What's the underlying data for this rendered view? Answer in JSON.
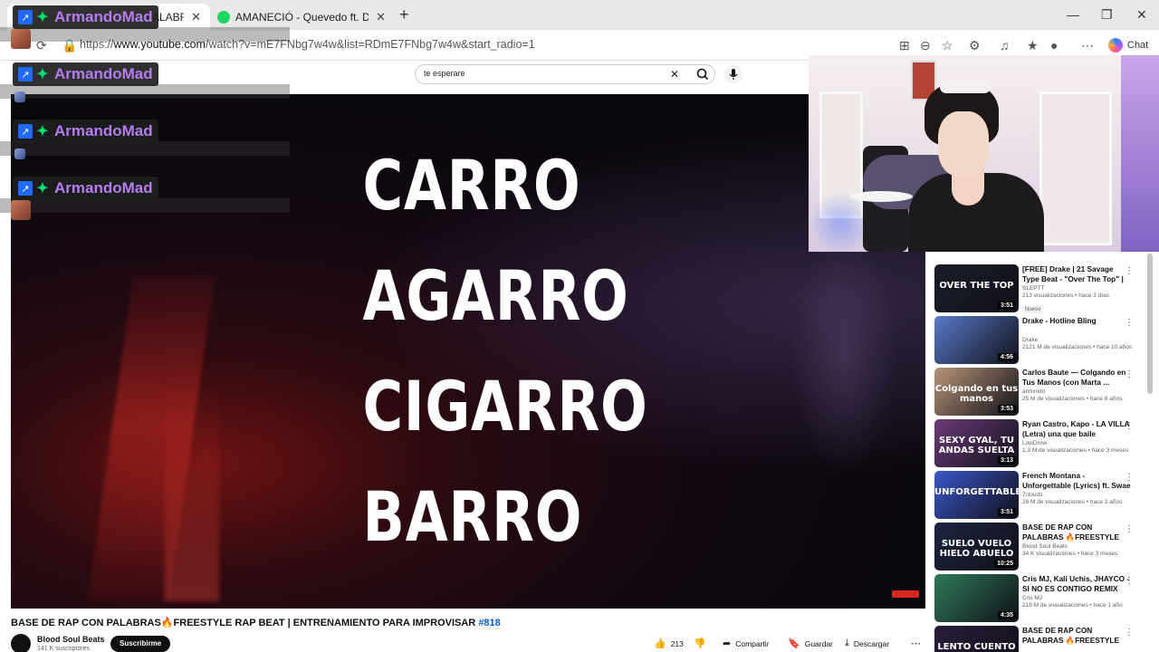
{
  "browser": {
    "tabs": [
      {
        "title": "ALABRA",
        "active": true
      },
      {
        "title": "AMANECIÓ - Quevedo ft. De La Rose",
        "active": false
      }
    ],
    "new_tab": "+",
    "url_prefix": "https://",
    "url_host": "www.youtube.com",
    "url_path": "/watch?v=mE7FNbg7w4w&list=RDmE7FNbg7w4w&start_radio=1",
    "chat_label": "Chat",
    "window_controls": [
      "—",
      "❐",
      "✕"
    ]
  },
  "youtube": {
    "search_value": "te esperare",
    "video": {
      "lyrics": [
        "CARRO",
        "AGARRO",
        "CIGARRO",
        "BARRO"
      ],
      "title": "BASE DE RAP CON PALABRAS🔥FREESTYLE RAP BEAT | ENTRENAMIENTO PARA IMPROVISAR",
      "hashtag": "#818"
    },
    "channel": {
      "name": "Blood Soul Beats",
      "subs": "141 K suscriptores",
      "subscribe_label": "Suscribirme"
    },
    "actions": {
      "likes": "213",
      "share": "Compartir",
      "save": "Guardar",
      "download": "Descargar"
    },
    "sidebar": [
      {
        "title": "[FREE] Drake | 21 Savage Type Beat - \"Over The Top\" | Hip Ho...",
        "channel": "SLEPTT",
        "stats": "213 visualizaciones • hace 3 días",
        "badge": "Nuevo",
        "duration": "3:51",
        "thumb_text": "OVER THE TOP",
        "thumb_color": "#1a1d2a"
      },
      {
        "title": "Drake - Hotline Bling",
        "channel": "Drake",
        "stats": "2121 M de visualizaciones • hace 10 años",
        "duration": "4:56",
        "thumb_text": "",
        "thumb_color": "#5a79c9"
      },
      {
        "title": "Carlos Baute — Colgando en Tus Manos (con Marta ...",
        "channel": "armxndo",
        "stats": "25 M de visualizaciones • hace 8 años",
        "duration": "3:53",
        "thumb_text": "Colgando en tus manos",
        "thumb_color": "#b79579"
      },
      {
        "title": "Ryan Castro, Kapo - LA VILLA (Letra) una que baile dancehal...",
        "channel": "LowDrow",
        "stats": "1,3 M de visualizaciones • hace 3 meses",
        "duration": "3:13",
        "thumb_text": "SEXY GYAL, TU ANDAS SUELTA",
        "thumb_color": "#6b3b7a"
      },
      {
        "title": "French Montana - Unforgettable (Lyrics) ft. Swae Lee",
        "channel": "7clouds",
        "stats": "26 M de visualizaciones • hace 3 años",
        "duration": "3:51",
        "thumb_text": "UNFORGETTABLE",
        "thumb_color": "#3b56c8"
      },
      {
        "title": "BASE DE RAP CON PALABRAS 🔥FREESTYLE RAP BEAT | ...",
        "channel": "Blood Soul Beats",
        "stats": "34 K visualizaciones • hace 3 meses",
        "duration": "10:25",
        "thumb_text": "SUELO VUELO HIELO ABUELO",
        "thumb_color": "#1d2540"
      },
      {
        "title": "Cris MJ, Kali Uchis, JHAYCO - SI NO ES CONTIGO REMIX",
        "channel": "Cris MJ",
        "stats": "218 M de visualizaciones • hace 1 año",
        "duration": "4:35",
        "thumb_text": "",
        "thumb_color": "#2f7a5a"
      },
      {
        "title": "BASE DE RAP CON PALABRAS 🔥FREESTYLE RAP BEAT | ...",
        "channel": "",
        "stats": "",
        "duration": "",
        "thumb_text": "LENTO CUENTO",
        "thumb_color": "#2a1d3a"
      }
    ]
  },
  "chat_overlay": [
    {
      "user": "ArmandoMad"
    },
    {
      "user": "ArmandoMad"
    },
    {
      "user": "ArmandoMad"
    },
    {
      "user": "ArmandoMad"
    }
  ],
  "colors": {
    "chat_name": "#b57cf2",
    "hashtag": "#065fd4",
    "subscribe_bg": "#0f0f0f"
  }
}
